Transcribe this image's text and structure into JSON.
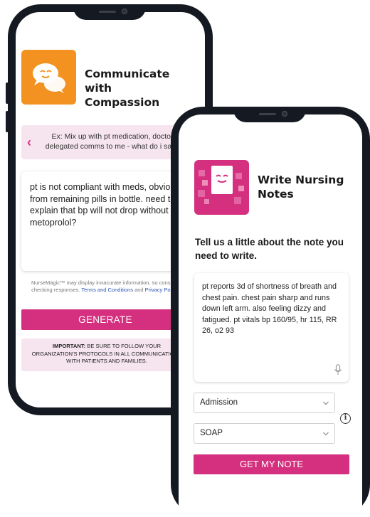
{
  "left_phone": {
    "app_icon": "chat-bubbles-icon",
    "title": "Communicate with Compassion",
    "example": "Ex: Mix up with pt medication, doctor delegated comms to me - what do i say?",
    "input_text": "pt is not compliant with meds, obviously from remaining pills in bottle. need to explain that bp will not drop without metoprolol?",
    "disclaimer_pre": "NurseMagic™ may display innacurate information, so consider checking responses.",
    "disclaimer_link_1": "Terms and Conditions",
    "disclaimer_and": "and",
    "disclaimer_link_2": "Privacy Policy.",
    "generate_label": "GENERATE",
    "important_label": "IMPORTANT:",
    "important_text": "BE SURE TO FOLLOW YOUR ORGANIZATION'S PROTOCOLS IN ALL COMMUNICATIONS WITH PATIENTS AND FAMILIES."
  },
  "right_phone": {
    "app_icon": "notes-document-icon",
    "title": "Write Nursing Notes",
    "prompt": "Tell us a little about the note you need to write.",
    "input_text": "pt reports 3d of shortness of breath and chest pain. chest pain sharp and runs down left arm. also feeling dizzy and fatigued. pt vitals bp 160/95, hr 115, RR 26, o2 93",
    "note_type": "Admission",
    "note_format": "SOAP",
    "submit_label": "GET MY NOTE"
  },
  "colors": {
    "accent_pink": "#d4307f",
    "accent_orange": "#f39220",
    "light_pink": "#f6e5ee",
    "phone_frame": "#151a22"
  }
}
